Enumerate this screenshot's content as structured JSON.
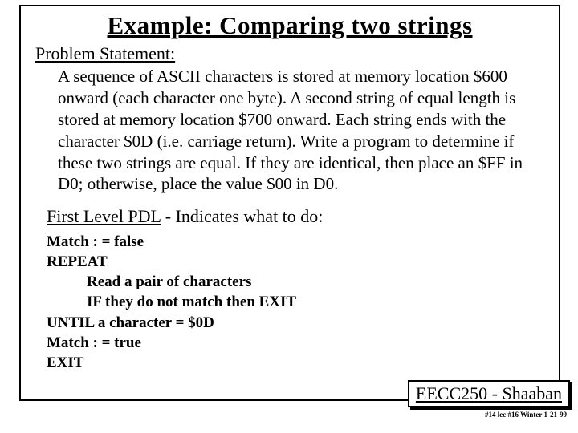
{
  "title": "Example:  Comparing two strings",
  "problem_label": "Problem Statement:",
  "problem_body": "A sequence of ASCII characters is  stored at memory location $600 onward (each character one byte).    A second string of equal length is stored at memory  location $700 onward.   Each string ends with the character $0D  (i.e. carriage return).   Write a program to determine if these two strings are equal.   If they are identical, then place an $FF in  D0; otherwise, place the value $00  in  D0.",
  "pdl_label_u": "First Level PDL",
  "pdl_label_rest": "   -   Indicates what to do:",
  "pdl": {
    "l1": "Match  : =  false",
    "l2": "REPEAT",
    "l3": "Read a pair of characters",
    "l4": "IF they do not match then EXIT",
    "l5": "UNTIL  a character  =  $0D",
    "l6": "Match : = true",
    "l7": "EXIT"
  },
  "footer_course": "EECC250 - Shaaban",
  "footer_small": "#14 lec #16  Winter 1-21-99"
}
